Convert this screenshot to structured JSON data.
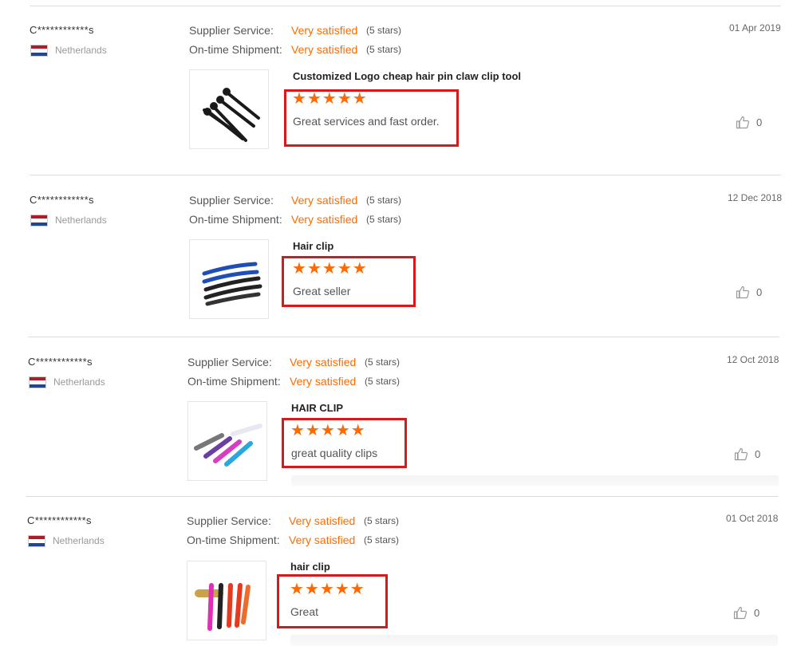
{
  "labels": {
    "supplier_service": "Supplier Service:",
    "ontime_shipment": "On-time Shipment:"
  },
  "colors": {
    "accent": "#ff6a00",
    "highlight": "#d7191c",
    "separator": "#dcdcdc"
  },
  "icons": {
    "flag": "netherlands-flag",
    "like": "thumbs-up-icon",
    "star": "star-icon"
  },
  "reviews": [
    {
      "buyer": "C************s",
      "country": "Netherlands",
      "date": "01 Apr 2019",
      "supplier_rating": "Very satisfied",
      "supplier_stars": "(5 stars)",
      "shipment_rating": "Very satisfied",
      "shipment_stars": "(5 stars)",
      "product": "Customized Logo cheap hair pin claw clip tool",
      "rating": 5,
      "comment": "Great services and fast order.",
      "likes": "0"
    },
    {
      "buyer": "C************s",
      "country": "Netherlands",
      "date": "12 Dec 2018",
      "supplier_rating": "Very satisfied",
      "supplier_stars": "(5 stars)",
      "shipment_rating": "Very satisfied",
      "shipment_stars": "(5 stars)",
      "product": "Hair clip",
      "rating": 5,
      "comment": "Great seller",
      "likes": "0"
    },
    {
      "buyer": "C************s",
      "country": "Netherlands",
      "date": "12 Oct 2018",
      "supplier_rating": "Very satisfied",
      "supplier_stars": "(5 stars)",
      "shipment_rating": "Very satisfied",
      "shipment_stars": "(5 stars)",
      "product": "HAIR CLIP",
      "rating": 5,
      "comment": "great quality clips",
      "likes": "0"
    },
    {
      "buyer": "C************s",
      "country": "Netherlands",
      "date": "01 Oct 2018",
      "supplier_rating": "Very satisfied",
      "supplier_stars": "(5 stars)",
      "shipment_rating": "Very satisfied",
      "shipment_stars": "(5 stars)",
      "product": "hair clip",
      "rating": 5,
      "comment": "Great",
      "likes": "0"
    }
  ]
}
